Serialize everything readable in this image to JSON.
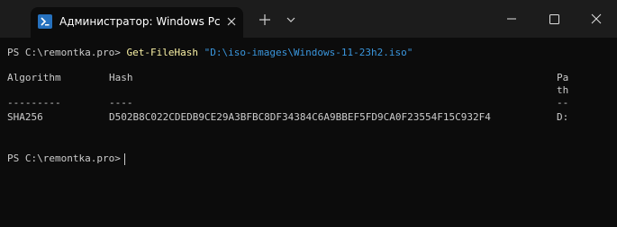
{
  "tab": {
    "title": "Администратор: Windows Pc",
    "icon": "powershell-icon"
  },
  "titlebar": {
    "new_tab_icon": "plus-icon",
    "dropdown_icon": "chevron-down-icon",
    "minimize_icon": "minimize-icon",
    "maximize_icon": "maximize-icon",
    "close_icon": "close-icon"
  },
  "terminal": {
    "prompt": "PS C:\\remontka.pro>",
    "command": {
      "cmdlet": "Get-FileHash",
      "argument": "\"D:\\iso-images\\Windows-11-23h2.iso\""
    },
    "table": {
      "headers": {
        "algorithm": "Algorithm",
        "hash": "Hash",
        "path_line1": "Pa",
        "path_line2": "th"
      },
      "underlines": {
        "algorithm": "---------",
        "hash": "----",
        "path": "--"
      },
      "row": {
        "algorithm": "SHA256",
        "hash": "D502B8C022CDEDB9CE29A3BFBC8DF34384C6A9BBEF5FD9CA0F23554F15C932F4",
        "path": "D:"
      }
    },
    "second_prompt": "PS C:\\remontka.pro>"
  },
  "colors": {
    "background": "#0c0c0c",
    "titlebar": "#1c1c1c",
    "text": "#cccccc",
    "cmdlet": "#f9f1a5",
    "argument": "#3a96dd"
  }
}
